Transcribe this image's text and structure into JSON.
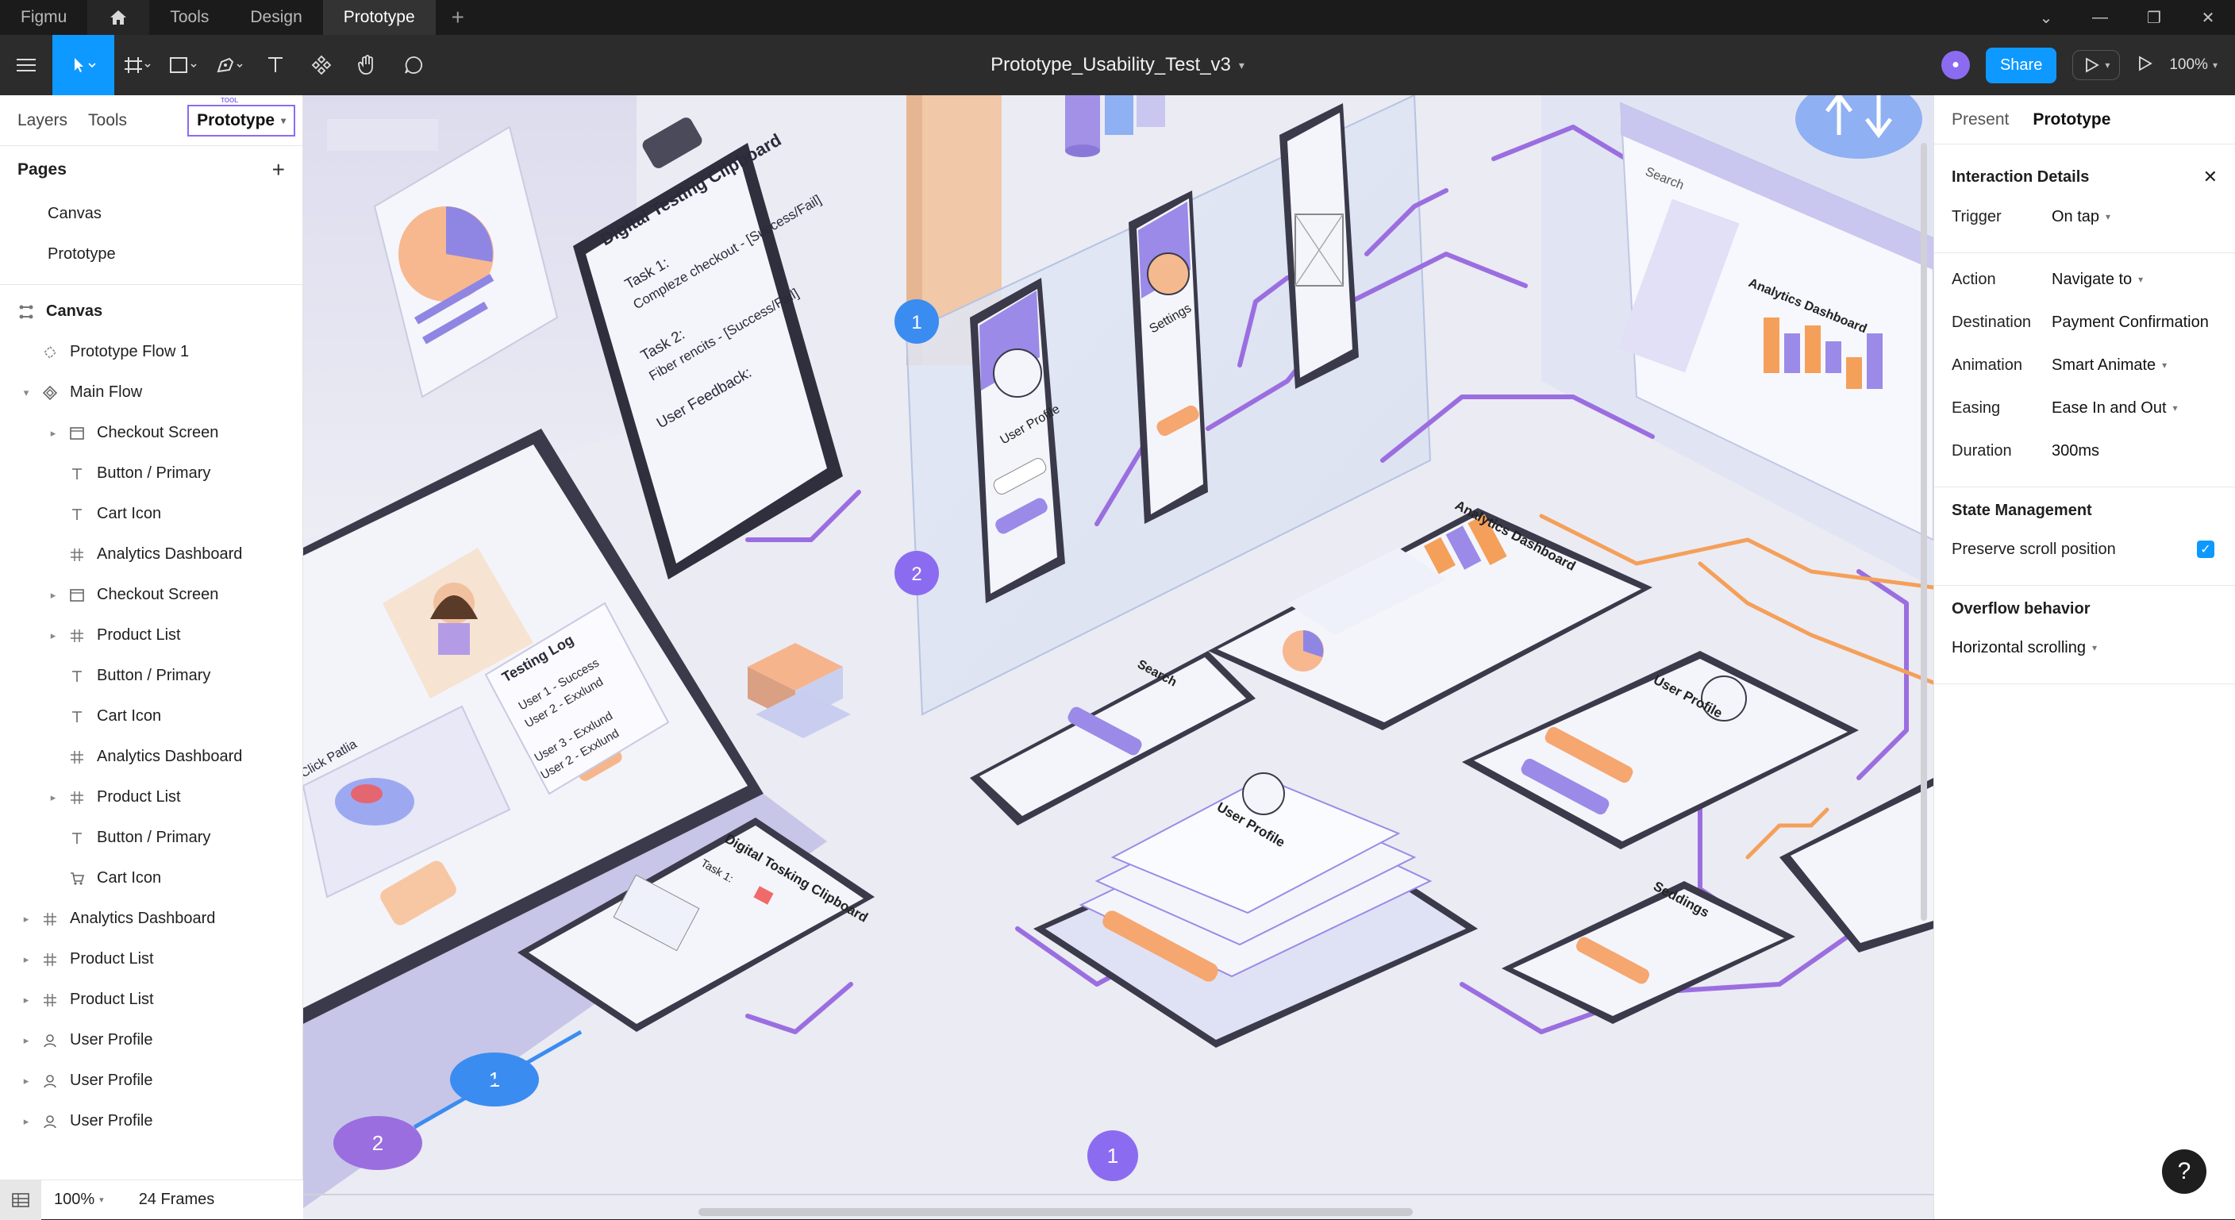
{
  "topbar": {
    "app": "Figmu",
    "tabs": [
      "Tools",
      "Design",
      "Prototype"
    ]
  },
  "toolbar": {
    "file_title": "Prototype_Usability_Test_v3",
    "share_label": "Share",
    "zoom": "100%"
  },
  "left_panel": {
    "tabs": [
      "Layers",
      "Tools",
      "Prototype"
    ],
    "tag": "TOOL",
    "pages_title": "Pages",
    "pages": [
      "Canvas",
      "Prototype"
    ],
    "canvas_title": "Canvas",
    "layers": [
      {
        "label": "Prototype Flow 1",
        "icon": "component-dash-icon",
        "indent": 1,
        "chevron": false
      },
      {
        "label": "Main Flow",
        "icon": "component-icon",
        "indent": 1,
        "chevron": true,
        "expanded": true
      },
      {
        "label": "Checkout Screen",
        "icon": "frame-icon",
        "indent": 2,
        "chevron": true
      },
      {
        "label": "Button / Primary",
        "icon": "text-icon",
        "indent": 2,
        "chevron": false
      },
      {
        "label": "Cart Icon",
        "icon": "text-icon",
        "indent": 2,
        "chevron": false
      },
      {
        "label": "Analytics Dashboard",
        "icon": "hash-icon",
        "indent": 2,
        "chevron": false
      },
      {
        "label": "Checkout Screen",
        "icon": "frame-icon",
        "indent": 2,
        "chevron": true
      },
      {
        "label": "Product List",
        "icon": "hash-icon",
        "indent": 2,
        "chevron": true
      },
      {
        "label": "Button / Primary",
        "icon": "text-icon",
        "indent": 2,
        "chevron": false
      },
      {
        "label": "Cart Icon",
        "icon": "text-icon",
        "indent": 2,
        "chevron": false
      },
      {
        "label": "Analytics Dashboard",
        "icon": "hash-icon",
        "indent": 2,
        "chevron": false
      },
      {
        "label": "Product List",
        "icon": "hash-icon",
        "indent": 2,
        "chevron": true
      },
      {
        "label": "Button / Primary",
        "icon": "text-icon",
        "indent": 2,
        "chevron": false
      },
      {
        "label": "Cart Icon",
        "icon": "cart-icon",
        "indent": 2,
        "chevron": false
      },
      {
        "label": "Analytics Dashboard",
        "icon": "hash-icon",
        "indent": 1,
        "chevron": true
      },
      {
        "label": "Product List",
        "icon": "hash-icon",
        "indent": 1,
        "chevron": true
      },
      {
        "label": "Product List",
        "icon": "hash-icon",
        "indent": 1,
        "chevron": true
      },
      {
        "label": "User Profile",
        "icon": "user-icon",
        "indent": 1,
        "chevron": true
      },
      {
        "label": "User Profile",
        "icon": "user-icon",
        "indent": 1,
        "chevron": true
      },
      {
        "label": "User Profile",
        "icon": "user-icon",
        "indent": 1,
        "chevron": true
      }
    ],
    "footer_zoom": "100%",
    "footer_frames": "24 Frames"
  },
  "canvas": {
    "clipboard_title": "Digital Testing Clipboard",
    "task1": "Task 1:",
    "task1_text": "Compleze checkout - [Success/Fail]",
    "task2": "Task 2:",
    "task2_text": "Fiber rencits - [Success/Fail]",
    "feedback": "User Feedback:",
    "testing_log": "Testing Log",
    "log_lines": [
      "User 1 - Success",
      "User 2 - Exxlund",
      "User 3 - Exxlund",
      "User 2 - Exxlund"
    ],
    "click_path": "Click Patlia",
    "user_profile": "User Profile",
    "settings": "Settings",
    "analytics": "Analytics Dashboard",
    "search": "Search",
    "badge_1": "1",
    "badge_2": "2",
    "clipboard_small": "Digital Tosking Clipboard",
    "task_small": "Task 1:",
    "settings2": "Seddings"
  },
  "right_panel": {
    "tabs": [
      "Present",
      "Prototype"
    ],
    "interaction_title": "Interaction Details",
    "trigger_label": "Trigger",
    "trigger_value": "On tap",
    "action_label": "Action",
    "action_value": "Navigate to",
    "destination_label": "Destination",
    "destination_value": "Payment Confirmation",
    "animation_label": "Animation",
    "animation_value": "Smart Animate",
    "easing_label": "Easing",
    "easing_value": "Ease In and Out",
    "duration_label": "Duration",
    "duration_value": "300ms",
    "state_title": "State Management",
    "preserve_label": "Preserve scroll position",
    "preserve_checked": true,
    "overflow_title": "Overflow behavior",
    "overflow_value": "Horizontal scrolling",
    "help": "?"
  },
  "colors": {
    "accent": "#0d99ff",
    "purple": "#8b6cf0",
    "flow_purple": "#9b6ee0",
    "flow_orange": "#f4a05a"
  }
}
